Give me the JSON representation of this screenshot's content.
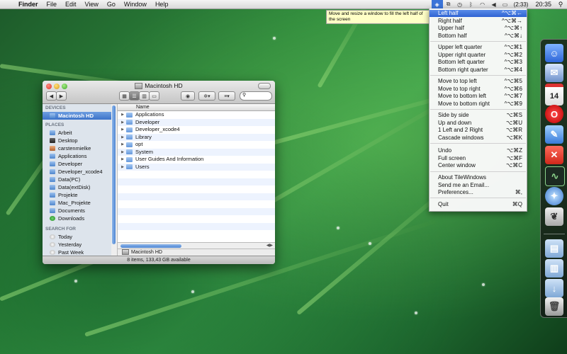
{
  "menubar": {
    "app_name": "Finder",
    "items": [
      "File",
      "Edit",
      "View",
      "Go",
      "Window",
      "Help"
    ],
    "battery": "(2:33)",
    "clock": "20:35"
  },
  "tooltip": {
    "text": "Move and resize a window to fill the left half of the screen"
  },
  "tilewindows_menu": {
    "items": [
      {
        "label": "Left half",
        "shortcut": "^⌥⌘←"
      },
      {
        "label": "Right half",
        "shortcut": "^⌥⌘→"
      },
      {
        "label": "Upper half",
        "shortcut": "^⌥⌘↑"
      },
      {
        "label": "Bottom half",
        "shortcut": "^⌥⌘↓"
      },
      {
        "label": "Upper left quarter",
        "shortcut": "^⌥⌘1"
      },
      {
        "label": "Upper right quarter",
        "shortcut": "^⌥⌘2"
      },
      {
        "label": "Bottom left quarter",
        "shortcut": "^⌥⌘3"
      },
      {
        "label": "Bottom right quarter",
        "shortcut": "^⌥⌘4"
      },
      {
        "label": "Move to top left",
        "shortcut": "^⌥⌘5"
      },
      {
        "label": "Move to top right",
        "shortcut": "^⌥⌘6"
      },
      {
        "label": "Move to bottom left",
        "shortcut": "^⌥⌘7"
      },
      {
        "label": "Move to bottom right",
        "shortcut": "^⌥⌘9"
      },
      {
        "label": "Side by side",
        "shortcut": "⌥⌘S"
      },
      {
        "label": "Up and down",
        "shortcut": "⌥⌘U"
      },
      {
        "label": "1 Left and 2 Right",
        "shortcut": "⌥⌘R"
      },
      {
        "label": "Cascade windows",
        "shortcut": "⌥⌘K"
      },
      {
        "label": "Undo",
        "shortcut": "⌥⌘Z"
      },
      {
        "label": "Full screen",
        "shortcut": "⌥⌘F"
      },
      {
        "label": "Center window",
        "shortcut": "⌥⌘C"
      },
      {
        "label": "About TileWindows",
        "shortcut": ""
      },
      {
        "label": "Send me an Email...",
        "shortcut": ""
      },
      {
        "label": "Preferences...",
        "shortcut": "⌘,"
      },
      {
        "label": "Quit",
        "shortcut": "⌘Q"
      }
    ]
  },
  "finder": {
    "title": "Macintosh HD",
    "sidebar": {
      "devices_header": "DEVICES",
      "devices": [
        "Macintosh HD"
      ],
      "places_header": "PLACES",
      "places": [
        "Arbeit",
        "Desktop",
        "carstenmielke",
        "Applications",
        "Developer",
        "Developer_xcode4",
        "Data(PC)",
        "Data(extDisk)",
        "Projekte",
        "Mac_Projekte",
        "Documents",
        "Downloads"
      ],
      "search_header": "SEARCH FOR",
      "search": [
        "Today",
        "Yesterday",
        "Past Week"
      ]
    },
    "list_header": "Name",
    "files": [
      "Applications",
      "Developer",
      "Developer_xcode4",
      "Library",
      "opt",
      "System",
      "User Guides And Information",
      "Users"
    ],
    "path": "Macintosh HD",
    "status": "8 items, 133,43 GB available"
  },
  "dock": {
    "calendar_day": "14"
  }
}
